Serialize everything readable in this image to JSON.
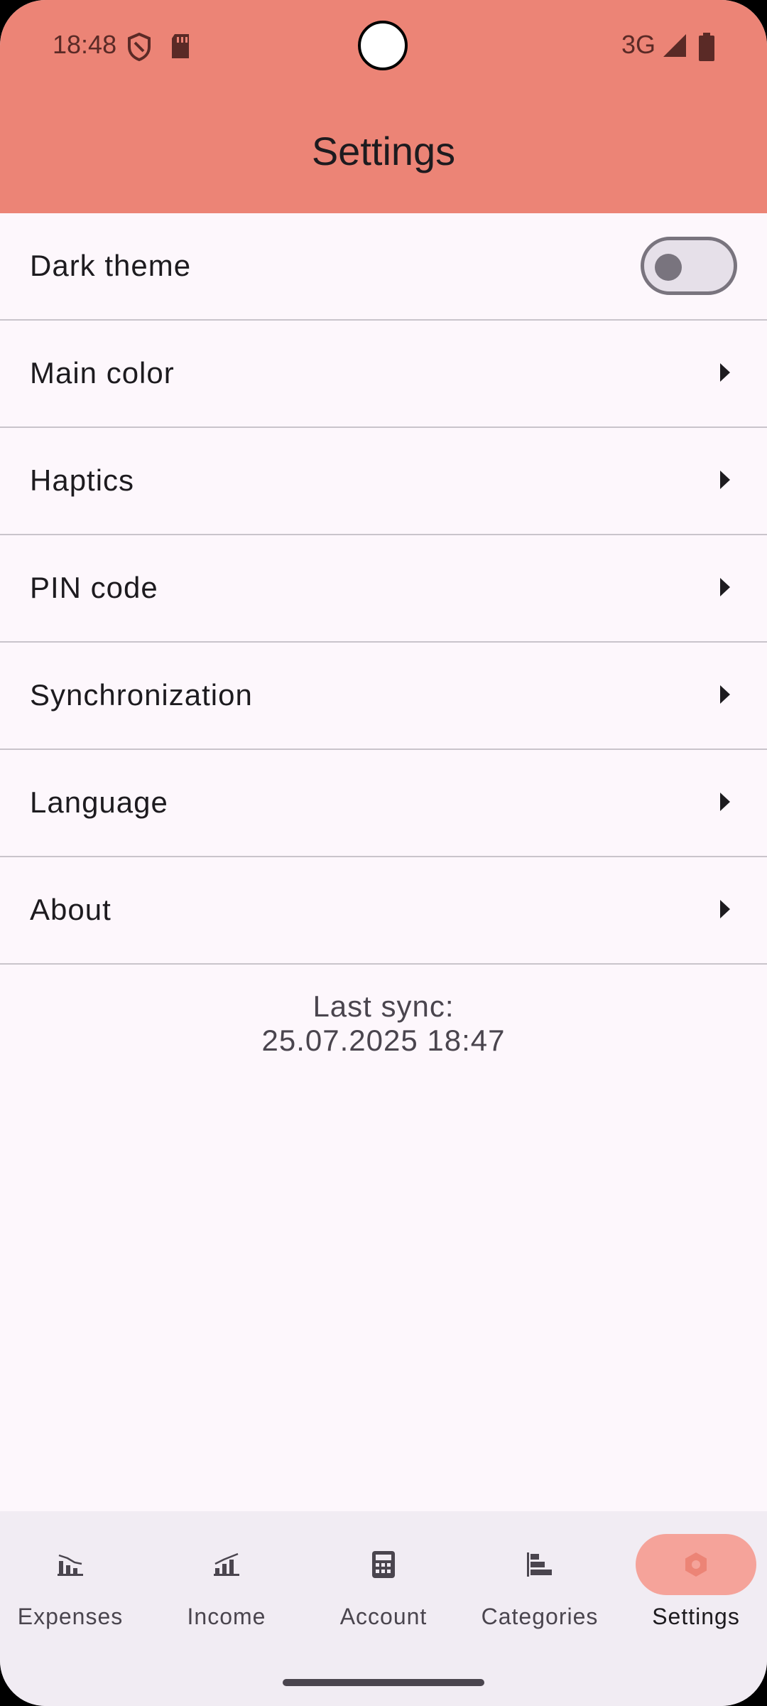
{
  "status_bar": {
    "time": "18:48",
    "network": "3G"
  },
  "header": {
    "title": "Settings"
  },
  "settings": {
    "dark_theme": {
      "label": "Dark theme",
      "enabled": false
    },
    "items": [
      {
        "label": "Main color"
      },
      {
        "label": "Haptics"
      },
      {
        "label": "PIN code"
      },
      {
        "label": "Synchronization"
      },
      {
        "label": "Language"
      },
      {
        "label": "About"
      }
    ]
  },
  "sync": {
    "label": "Last sync:",
    "datetime": "25.07.2025 18:47"
  },
  "bottom_nav": {
    "items": [
      {
        "label": "Expenses",
        "icon": "expenses-chart-icon",
        "active": false
      },
      {
        "label": "Income",
        "icon": "income-chart-icon",
        "active": false
      },
      {
        "label": "Account",
        "icon": "calculator-icon",
        "active": false
      },
      {
        "label": "Categories",
        "icon": "categories-bars-icon",
        "active": false
      },
      {
        "label": "Settings",
        "icon": "settings-gear-icon",
        "active": true
      }
    ]
  },
  "colors": {
    "header": "#EC8476",
    "background": "#FDF7FC",
    "nav_background": "#F1ECF3",
    "active_indicator": "#F5A39A"
  }
}
